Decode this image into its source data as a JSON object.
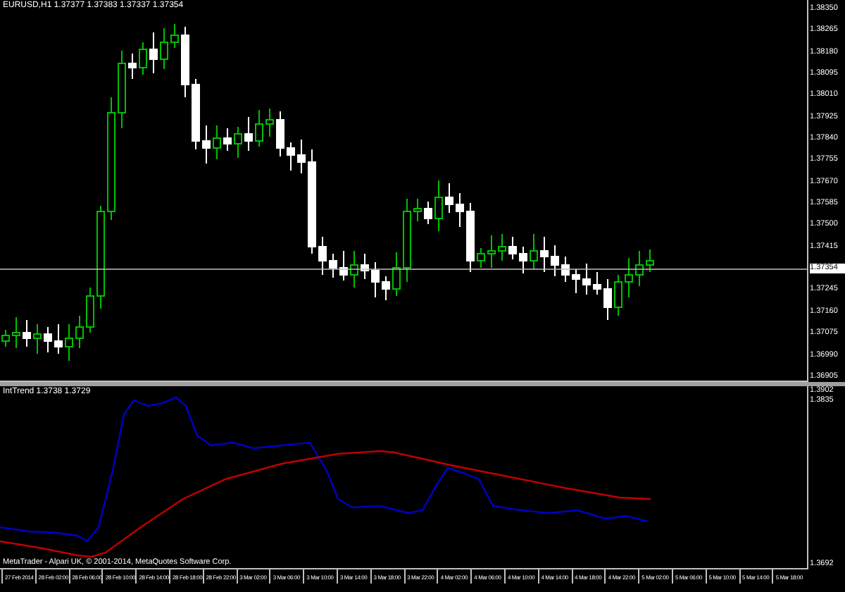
{
  "chart": {
    "title": "EURUSD,H1  1.37377 1.37383 1.37337 1.37354",
    "price_axis": [
      {
        "label": "1.38350",
        "current": false
      },
      {
        "label": "1.38265",
        "current": false
      },
      {
        "label": "1.38180",
        "current": false
      },
      {
        "label": "1.38095",
        "current": false
      },
      {
        "label": "1.38010",
        "current": false
      },
      {
        "label": "1.37925",
        "current": false
      },
      {
        "label": "1.37840",
        "current": false
      },
      {
        "label": "1.37755",
        "current": false
      },
      {
        "label": "1.37670",
        "current": false
      },
      {
        "label": "1.37585",
        "current": false
      },
      {
        "label": "1.37500",
        "current": false
      },
      {
        "label": "1.37415",
        "current": false
      },
      {
        "label": "1.37354",
        "current": true
      },
      {
        "label": "1.37245",
        "current": false
      },
      {
        "label": "1.37160",
        "current": false
      },
      {
        "label": "1.37075",
        "current": false
      },
      {
        "label": "1.36990",
        "current": false
      },
      {
        "label": "1.36905",
        "current": false
      }
    ]
  },
  "indicator": {
    "title": "IntTrend 1.3738 1.3729",
    "axis": [
      "1.3902",
      "1.3835",
      "1.3692"
    ]
  },
  "copyright": "MetaTrader - Alpari UK, © 2001-2014, MetaQuotes Software Corp.",
  "time_axis": [
    "27 Feb 2014",
    "28 Feb 02:00",
    "28 Feb 06:00",
    "28 Feb 10:00",
    "28 Feb 14:00",
    "28 Feb 18:00",
    "28 Feb 22:00",
    "3 Mar 02:00",
    "3 Mar 06:00",
    "3 Mar 10:00",
    "3 Mar 14:00",
    "3 Mar 18:00",
    "3 Mar 22:00",
    "4 Mar 02:00",
    "4 Mar 06:00",
    "4 Mar 10:00",
    "4 Mar 14:00",
    "4 Mar 18:00",
    "4 Mar 22:00",
    "5 Mar 02:00",
    "5 Mar 06:00",
    "5 Mar 10:00",
    "5 Mar 14:00",
    "5 Mar 18:00"
  ]
}
